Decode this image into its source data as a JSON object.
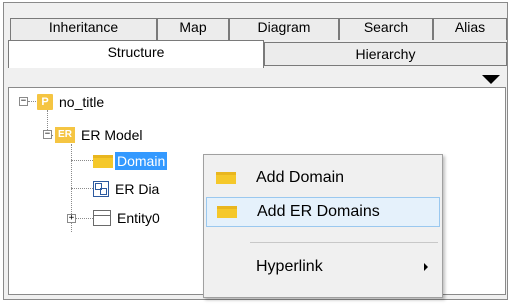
{
  "tabs_row1": [
    {
      "label": "Inheritance"
    },
    {
      "label": "Map"
    },
    {
      "label": "Diagram"
    },
    {
      "label": "Search"
    },
    {
      "label": "Alias"
    }
  ],
  "tabs_row2": [
    {
      "label": "Structure",
      "active": true
    },
    {
      "label": "Hierarchy",
      "active": false
    }
  ],
  "tree": {
    "root": {
      "label": "no_title",
      "icon": "project-icon",
      "icon_text": "P",
      "expander": "−"
    },
    "er_model": {
      "label": "ER Model",
      "icon": "er-model-icon",
      "icon_text": "ER",
      "expander": "−"
    },
    "domains": {
      "label": "Domain",
      "icon": "folder-icon",
      "selected": true
    },
    "er_diagram": {
      "label": "ER Dia",
      "icon": "diagram-icon"
    },
    "entity": {
      "label": "Entity0",
      "icon": "entity-icon",
      "expander": "+"
    }
  },
  "context_menu": {
    "items": [
      {
        "label": "Add Domain",
        "icon": "folder-icon"
      },
      {
        "label": "Add ER Domains",
        "icon": "folder-icon",
        "hovered": true
      },
      {
        "label": "Hyperlink",
        "submenu": true
      }
    ]
  },
  "colors": {
    "selection": "#3399ff",
    "folder": "#f5c82a",
    "badge": "#f5c542",
    "menu_hover": "#e5f1fb"
  }
}
